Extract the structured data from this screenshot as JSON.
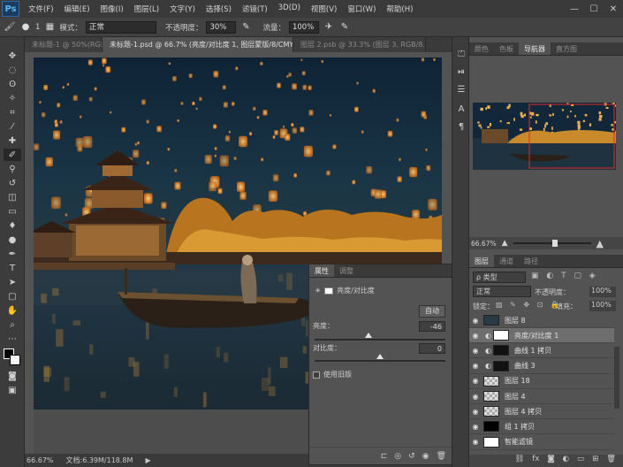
{
  "app": {
    "logo": "Ps"
  },
  "menu": [
    "文件(F)",
    "编辑(E)",
    "图像(I)",
    "图层(L)",
    "文字(Y)",
    "选择(S)",
    "滤镜(T)",
    "3D(D)",
    "视图(V)",
    "窗口(W)",
    "帮助(H)"
  ],
  "window_controls": [
    "—",
    "☐",
    "✕"
  ],
  "options": {
    "brush_size": "1",
    "mode_label": "模式：",
    "mode_value": "正常",
    "opacity_label": "不透明度：",
    "opacity_value": "30%",
    "flow_label": "流量：",
    "flow_value": "100%"
  },
  "tabs": [
    {
      "label": "未标题-1 @ 50%(RGB/..."
    },
    {
      "label": "未标题-1.psd @ 66.7% (亮度/对比度 1, 图层蒙版/8/CMYK) *"
    },
    {
      "label": "图层 2.psb @ 33.3% (图层 3, RGB/8..."
    }
  ],
  "status": {
    "zoom": "66.67%",
    "doc": "文档:6.39M/118.8M"
  },
  "navigator": {
    "tabs": [
      "颜色",
      "色板",
      "导航器",
      "直方图"
    ],
    "zoom": "66.67%"
  },
  "layers": {
    "tabs": [
      "图层",
      "通道",
      "路径"
    ],
    "filter_kind": "ρ 类型",
    "blend_mode": "正常",
    "opacity_label": "不透明度：",
    "opacity_value": "100%",
    "lock_label": "锁定：",
    "fill_label": "填充：",
    "fill_value": "100%",
    "items": [
      {
        "name": "图层 8",
        "thumb": "dark"
      },
      {
        "name": "亮度/对比度 1",
        "thumb": "adjust",
        "selected": true
      },
      {
        "name": "曲线 1 拷贝",
        "thumb": "curve"
      },
      {
        "name": "曲线 3",
        "thumb": "curve"
      },
      {
        "name": "图层 18",
        "thumb": "checker"
      },
      {
        "name": "图层 4",
        "thumb": "checker"
      },
      {
        "name": "图层 4 拷贝",
        "thumb": "checker"
      },
      {
        "name": "组 1 拷贝",
        "thumb": "group"
      },
      {
        "name": "智能滤镜",
        "thumb": "white"
      }
    ]
  },
  "properties": {
    "tabs": [
      "属性",
      "调整"
    ],
    "title": "亮度/对比度",
    "auto_button": "自动",
    "brightness_label": "亮度：",
    "brightness_value": "-46",
    "brightness_level": 0.41,
    "contrast_label": "对比度：",
    "contrast_value": "0",
    "contrast_level": 0.5,
    "legacy_label": "使用旧版"
  }
}
